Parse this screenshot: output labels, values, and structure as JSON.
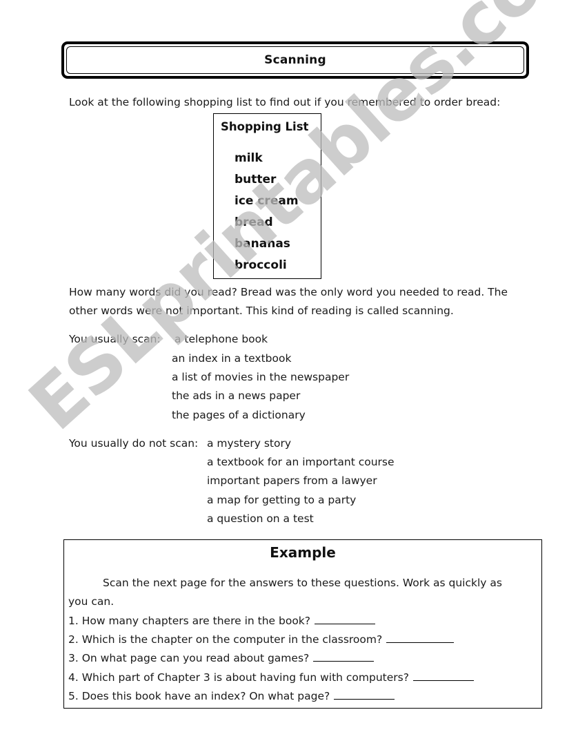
{
  "title": "Scanning",
  "intro": "Look at the following shopping list to find out if you remembered to order bread:",
  "shopping_list": {
    "heading": "Shopping List",
    "items": [
      "milk",
      "butter",
      "ice cream",
      "bread",
      "bananas",
      "broccoli"
    ]
  },
  "explanation": {
    "line1": "How many words did you read? Bread was the only word you needed to read. The",
    "line2": "other words were not important. This kind of reading is called scanning."
  },
  "scan": {
    "label": "You usually scan:",
    "items": [
      "a telephone book",
      "an index in a textbook",
      "a list of movies in the newspaper",
      "the ads in a news paper",
      "the pages of a dictionary"
    ]
  },
  "no_scan": {
    "label": "You usually do not scan:",
    "items": [
      "a mystery story",
      "a textbook for an important course",
      "important papers from a lawyer",
      "a map for getting to a party",
      "a question on a test"
    ]
  },
  "example": {
    "heading": "Example",
    "instructions_line1": "Scan the next page for the answers to these questions. Work as quickly as",
    "instructions_line2": "you can.",
    "questions": [
      "1. How many chapters are there in the book?",
      "2. Which is the chapter on the computer in the classroom?",
      "3. On what page can you read about games?",
      "4. Which part of Chapter 3 is about having fun with computers?",
      "5. Does this book have an index? On what page?"
    ]
  },
  "watermark": "ESLprintables.com"
}
